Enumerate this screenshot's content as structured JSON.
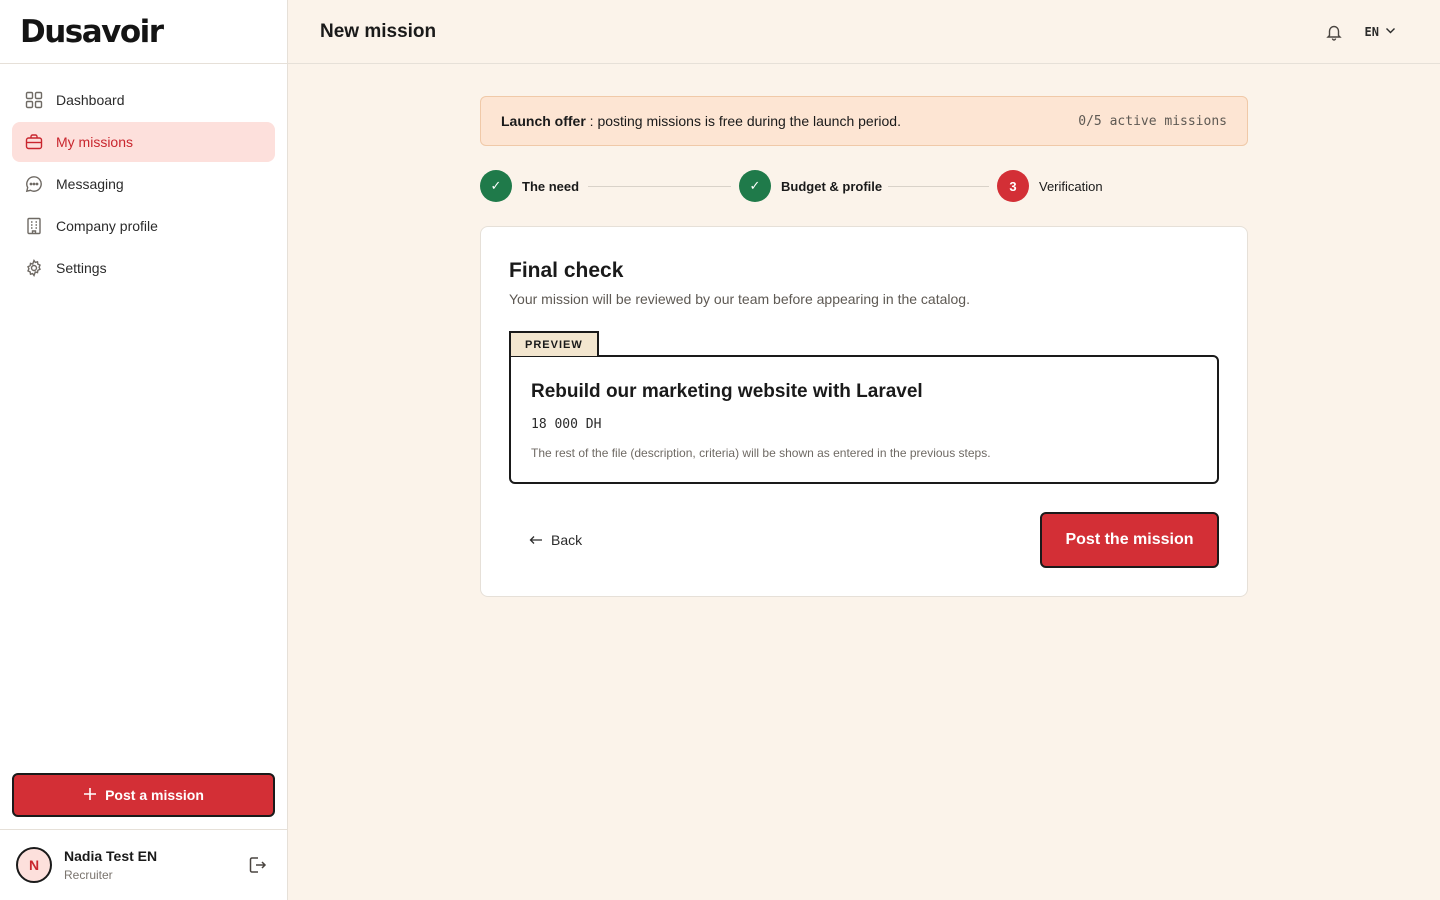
{
  "app": {
    "logo_text": "Dusavoir"
  },
  "sidebar": {
    "items": [
      {
        "label": "Dashboard",
        "icon": "grid-icon"
      },
      {
        "label": "My missions",
        "icon": "briefcase-icon"
      },
      {
        "label": "Messaging",
        "icon": "chat-icon"
      },
      {
        "label": "Company profile",
        "icon": "building-icon"
      },
      {
        "label": "Settings",
        "icon": "gear-icon"
      }
    ],
    "active": "My missions",
    "post_button_label": "Post a mission",
    "user": {
      "initial": "N",
      "name": "Nadia Test EN",
      "role": "Recruiter"
    }
  },
  "header": {
    "title": "New mission",
    "language": "EN"
  },
  "banner": {
    "title": "Launch offer",
    "text": " : posting missions is free during the launch period.",
    "count": "0/5 active missions"
  },
  "stepper": {
    "steps": [
      {
        "marker": "✓",
        "label": "The need",
        "state": "done"
      },
      {
        "marker": "✓",
        "label": "Budget & profile",
        "state": "done"
      },
      {
        "marker": "3",
        "label": "Verification",
        "state": "current"
      }
    ]
  },
  "card": {
    "title": "Final check",
    "subtitle": "Your mission will be reviewed by our team before appearing in the catalog.",
    "preview_tab": "PREVIEW",
    "preview": {
      "title": "Rebuild our marketing website with Laravel",
      "budget": "18 000 DH",
      "note": "The rest of the file (description, criteria) will be shown as entered in the previous steps."
    },
    "back_label": "Back",
    "submit_label": "Post the mission"
  },
  "colors": {
    "accent": "#d32f36",
    "success": "#1f7a4a",
    "background": "#fbf3ea",
    "banner": "#fde5d3"
  }
}
